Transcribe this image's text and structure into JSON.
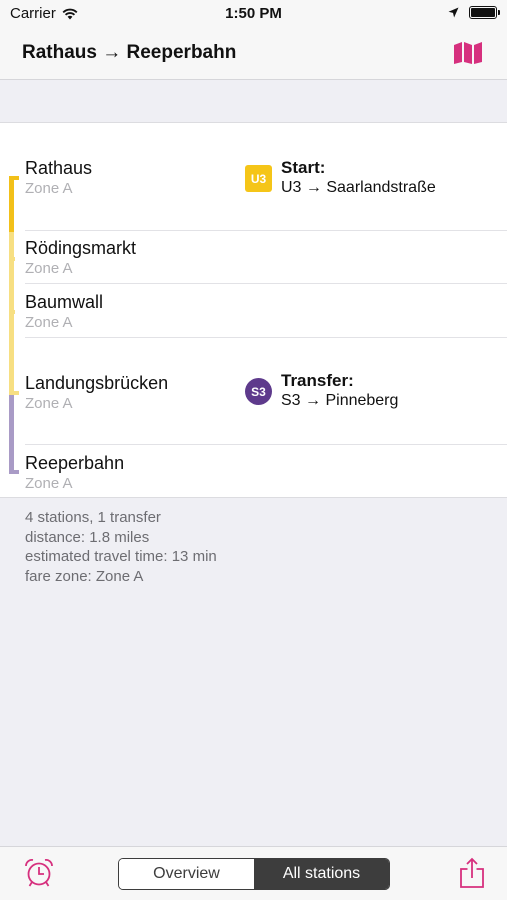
{
  "status_bar": {
    "carrier": "Carrier",
    "time": "1:50 PM"
  },
  "nav": {
    "title": "Rathaus → Reeperbahn",
    "map_icon": "map-icon",
    "accent_color": "#d6307e"
  },
  "stations": [
    {
      "name": "Rathaus",
      "zone": "Zone A"
    },
    {
      "name": "Rödingsmarkt",
      "zone": "Zone A"
    },
    {
      "name": "Baumwall",
      "zone": "Zone A"
    },
    {
      "name": "Landungsbrücken",
      "zone": "Zone A"
    },
    {
      "name": "Reeperbahn",
      "zone": "Zone A"
    }
  ],
  "legs": [
    {
      "badge": "U3",
      "title": "Start:",
      "detail": "U3 → Saarlandstraße",
      "color": "#f5c518"
    },
    {
      "badge": "S3",
      "title": "Transfer:",
      "detail": "S3 → Pinneberg",
      "color": "#5e3a8c"
    }
  ],
  "line_colors": {
    "u3_strong": "#f2c019",
    "u3_light": "#f7df82",
    "s3": "#a99bc6"
  },
  "summary": {
    "stations": "4 stations, 1 transfer",
    "distance": "distance: 1.8 miles",
    "time": "estimated travel time: 13 min",
    "fare": "fare zone: Zone A"
  },
  "tab_bar": {
    "alarm_icon": "alarm-clock-icon",
    "share_icon": "share-icon",
    "segments": [
      {
        "label": "Overview",
        "selected": false
      },
      {
        "label": "All stations",
        "selected": true
      }
    ]
  }
}
